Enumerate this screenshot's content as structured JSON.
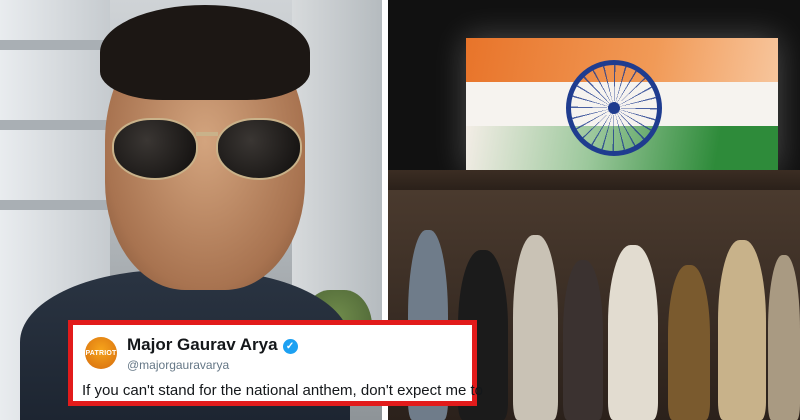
{
  "tweet": {
    "avatar_text": "PATRIOT",
    "name": "Major Gaurav Arya",
    "handle": "@majorgauravarya",
    "text": "If you can't stand for the national anthem, don't expect me to",
    "verified_icon": "✓",
    "border_color": "#e21b1b",
    "verified_color": "#1da1f2"
  },
  "images": {
    "left": "man-wearing-aviator-sunglasses",
    "right": "cinema-audience-standing-indian-flag"
  }
}
